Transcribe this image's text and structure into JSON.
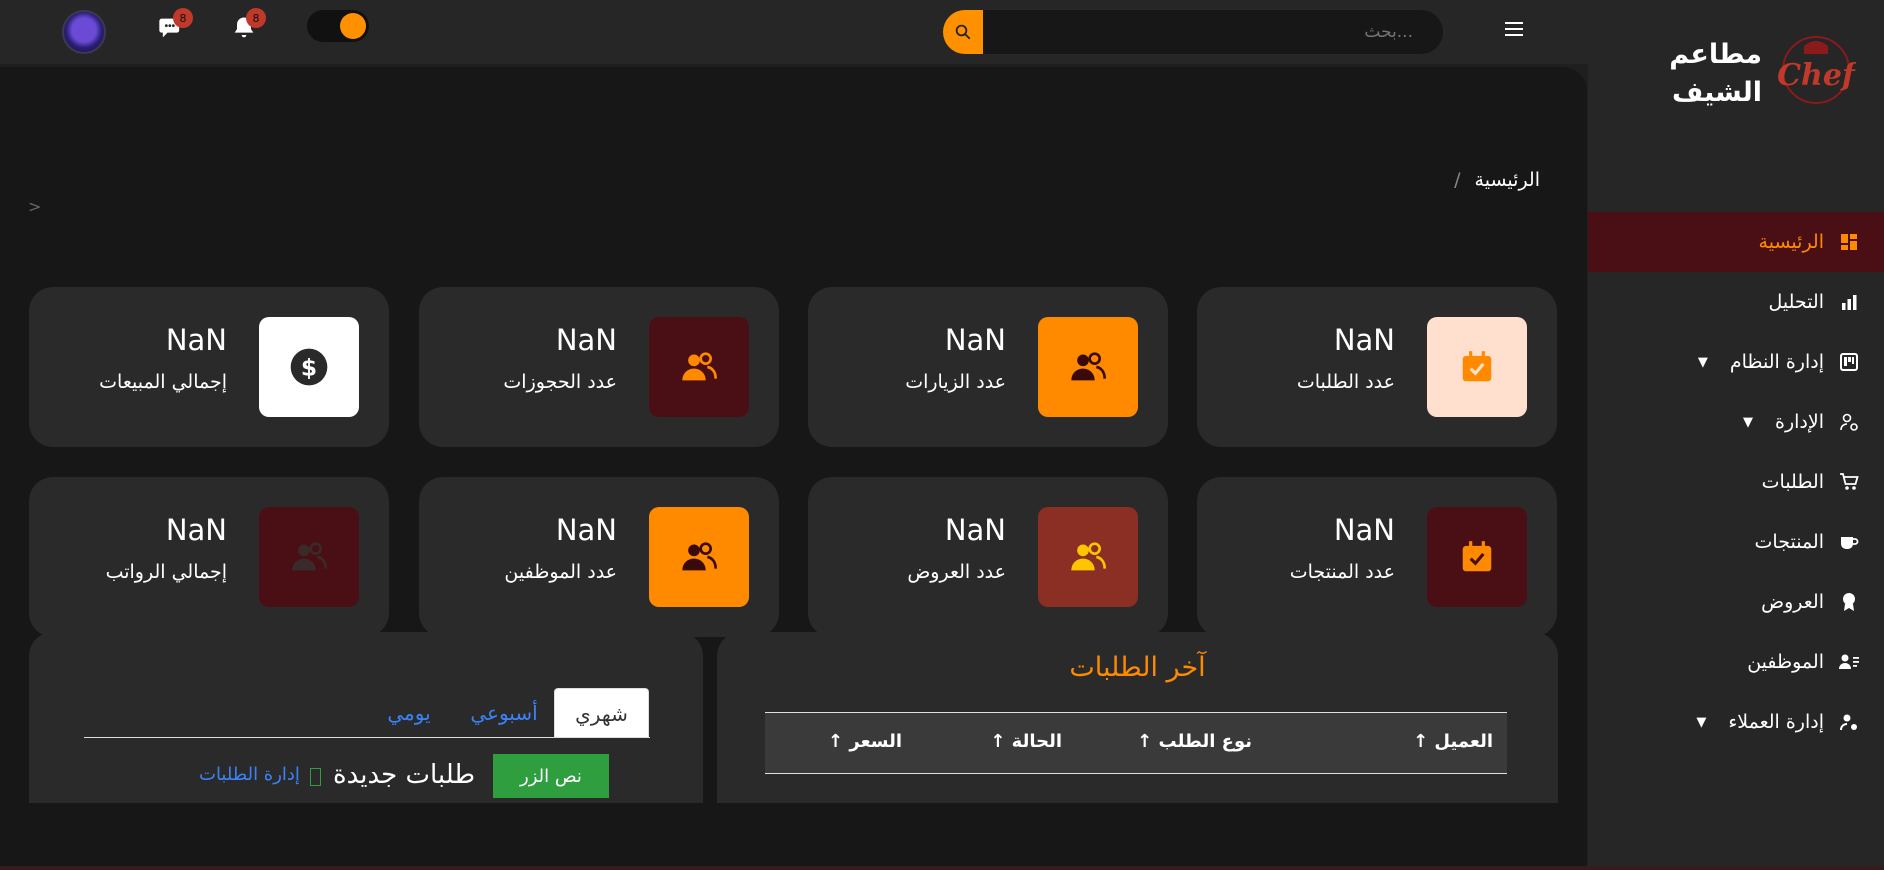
{
  "brand": {
    "name_line1": "مطاعم",
    "name_line2": "الشيف",
    "logo_text": "Chef"
  },
  "search": {
    "placeholder": "بحث..."
  },
  "notifications": {
    "messages_count": "8",
    "alerts_count": "8"
  },
  "breadcrumb": {
    "home": "الرئيسية",
    "separator": "/"
  },
  "pager_hint": ">",
  "sidebar": {
    "items": [
      {
        "label": "الرئيسية",
        "icon": "dashboard-icon",
        "active": true
      },
      {
        "label": "التحليل",
        "icon": "bar-chart-icon"
      },
      {
        "label": "إدارة النظام",
        "icon": "kanban-icon",
        "has_submenu": true
      },
      {
        "label": "الإدارة",
        "icon": "user-gear-icon",
        "has_submenu": true
      },
      {
        "label": "الطلبات",
        "icon": "cart-icon"
      },
      {
        "label": "المنتجات",
        "icon": "cup-icon"
      },
      {
        "label": "العروض",
        "icon": "award-icon"
      },
      {
        "label": "الموظفين",
        "icon": "person-lines-icon"
      },
      {
        "label": "إدارة العملاء",
        "icon": "user-gear-icon",
        "has_submenu": true
      }
    ],
    "active_color": "#ff8a00"
  },
  "stats": [
    {
      "value": "NaN",
      "label": "عدد الطلبات",
      "icon": "calendar-check-icon",
      "bg": "#ffe0cf",
      "fg": "#ff8a00"
    },
    {
      "value": "NaN",
      "label": "عدد الزيارات",
      "icon": "users-icon",
      "bg": "#ff8a00",
      "fg": "#3a0a0a"
    },
    {
      "value": "NaN",
      "label": "عدد الحجوزات",
      "icon": "users-icon",
      "bg": "#4a0f14",
      "fg": "#ff8a00"
    },
    {
      "value": "NaN",
      "label": "إجمالي المبيعات",
      "icon": "dollar-icon",
      "bg": "#ffffff",
      "fg": "#2a2a2a"
    },
    {
      "value": "NaN",
      "label": "عدد المنتجات",
      "icon": "calendar-check-icon",
      "bg": "#4a0f14",
      "fg": "#ff8a00"
    },
    {
      "value": "NaN",
      "label": "عدد العروض",
      "icon": "users-icon",
      "bg": "#8b2e24",
      "fg": "#ffc400"
    },
    {
      "value": "NaN",
      "label": "عدد الموظفين",
      "icon": "users-icon",
      "bg": "#ff8a00",
      "fg": "#3a0a0a"
    },
    {
      "value": "NaN",
      "label": "إجمالي الرواتب",
      "icon": "users-icon",
      "bg": "#4a0f14",
      "fg": "#3a2a2a"
    }
  ],
  "orders": {
    "title": "آخر الطلبات",
    "columns": [
      "العميل ↑",
      "نوع الطلب ↑",
      "الحالة ↑",
      "السعر ↑"
    ]
  },
  "chart_panel": {
    "tabs": [
      "شهري",
      "أسبوعي",
      "يومي"
    ],
    "active_tab": "شهري",
    "button_label": "نص الزر",
    "heading": "طلبات جديدة",
    "link": "إدارة الطلبات"
  }
}
